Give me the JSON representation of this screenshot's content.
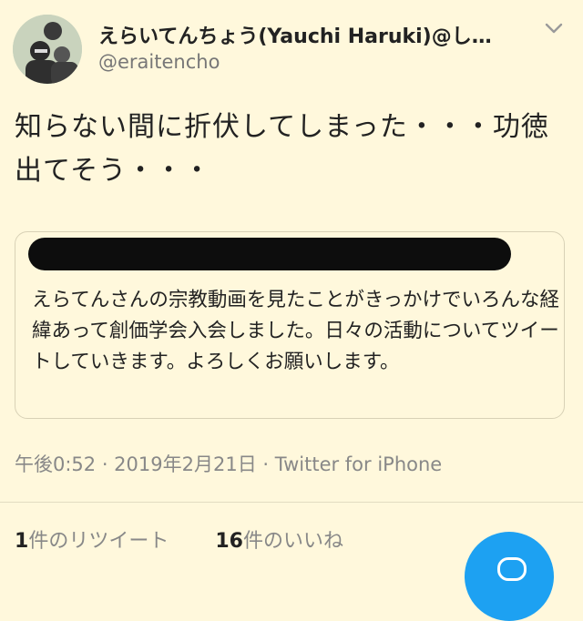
{
  "user": {
    "display_name": "えらいてんちょう(Yauchi Haruki)@し…",
    "handle": "@eraitencho"
  },
  "tweet": {
    "text": "知らない間に折伏してしまった・・・功徳出てそう・・・"
  },
  "card": {
    "body": "えらてんさんの宗教動画を見たことがきっかけでいろんな経緯あって創価学会入会しました。日々の活動についてツイートしていきます。よろしくお願いします。"
  },
  "meta": {
    "timestamp": "午後0:52 · 2019年2月21日 · Twitter for iPhone"
  },
  "stats": {
    "retweets_count": "1",
    "retweets_label": "件のリツイート",
    "likes_count": "16",
    "likes_label": "件のいいね"
  },
  "colors": {
    "background": "#fff8dc",
    "accent": "#1da1f2"
  },
  "icons": {
    "menu": "chevron-down-icon",
    "compose": "reply-icon"
  }
}
